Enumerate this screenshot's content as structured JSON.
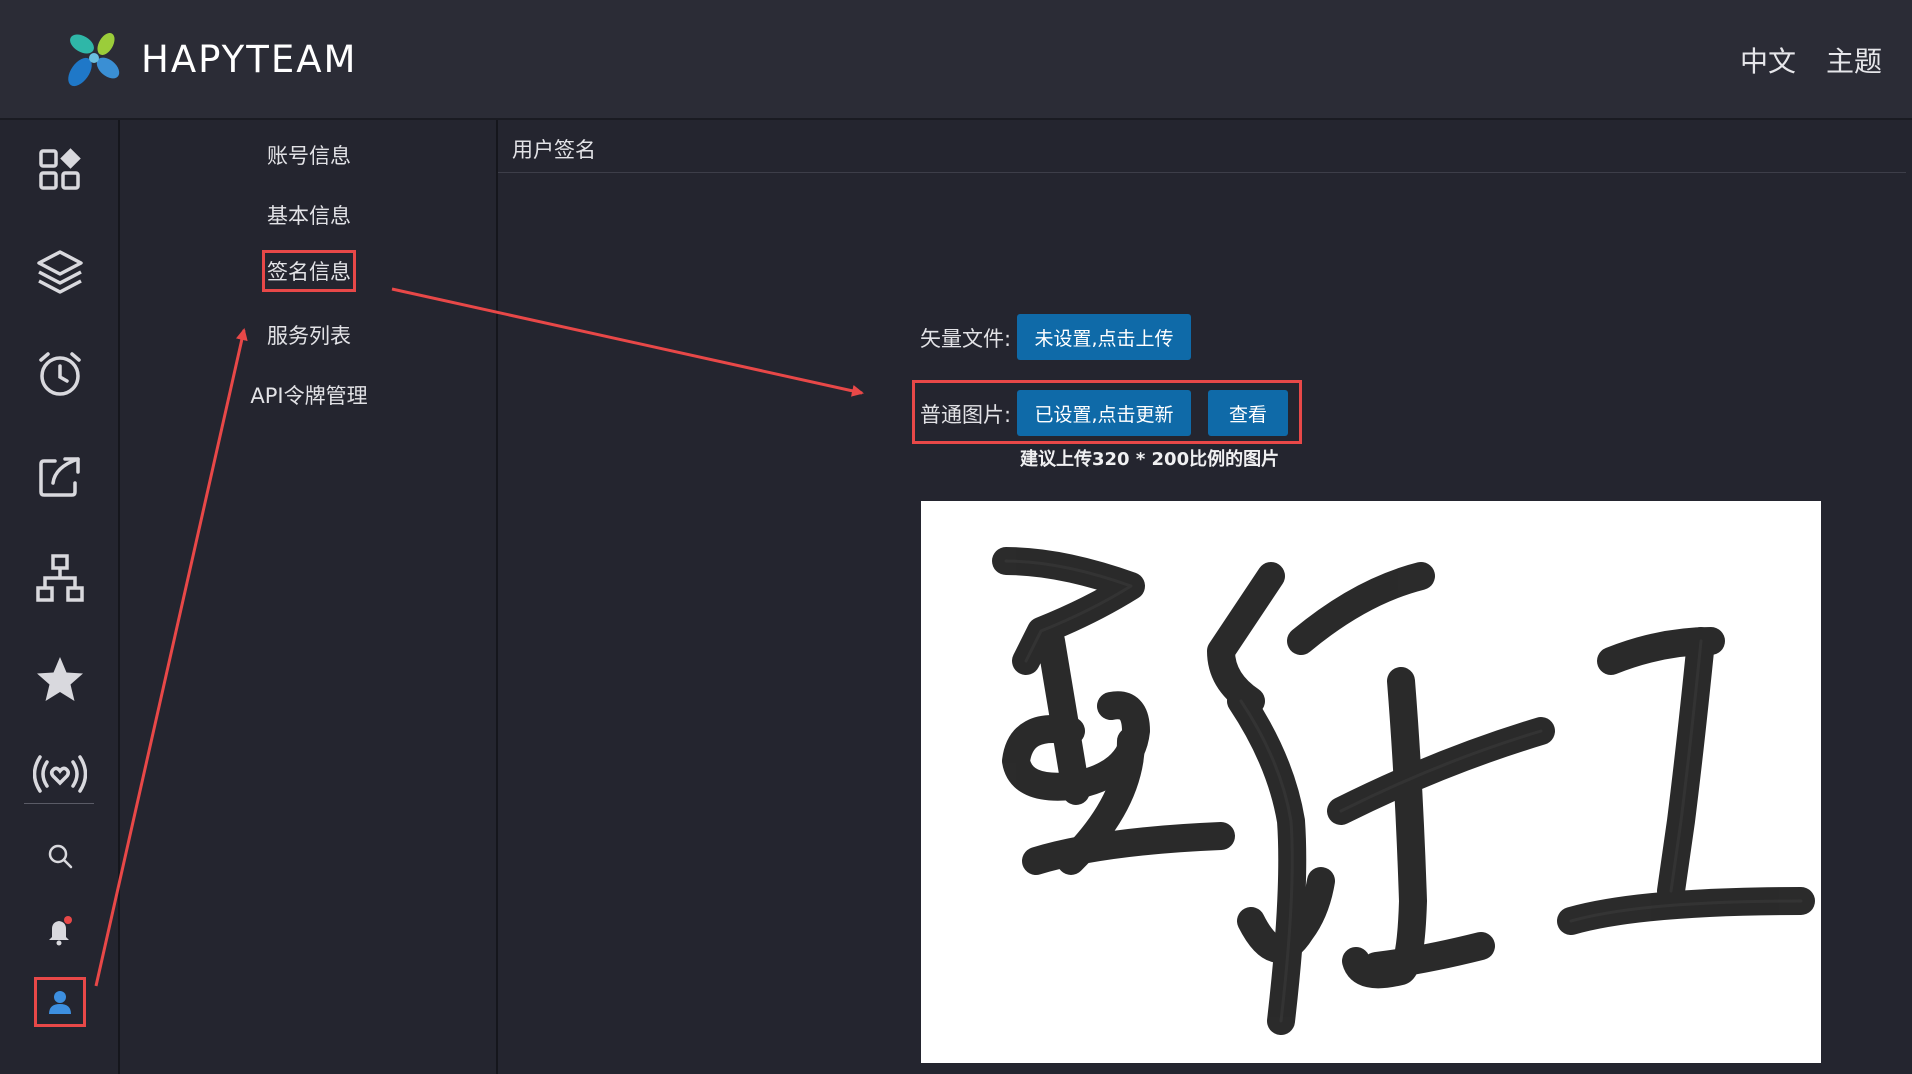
{
  "header": {
    "brand": "HAPYTEAM",
    "language": "中文",
    "theme": "主题"
  },
  "rail": {
    "icons": [
      "dashboard-icon",
      "layers-icon",
      "alarm-clock-icon",
      "share-icon",
      "sitemap-icon",
      "star-icon",
      "broadcast-icon",
      "search-icon",
      "bell-icon",
      "user-icon"
    ]
  },
  "subnav": {
    "items": [
      {
        "label": "账号信息"
      },
      {
        "label": "基本信息"
      },
      {
        "label": "签名信息"
      },
      {
        "label": "服务列表"
      },
      {
        "label": "API令牌管理"
      }
    ]
  },
  "main": {
    "title": "用户签名",
    "vector_label": "矢量文件:",
    "vector_button": "未设置,点击上传",
    "image_label": "普通图片:",
    "image_button": "已设置,点击更新",
    "view_button": "查看",
    "hint": "建议上传320 * 200比例的图片"
  },
  "colors": {
    "accent_button": "#0f6aa8",
    "highlight": "#e84848",
    "notification_dot": "#e84848",
    "user_icon": "#3d8fe0"
  }
}
